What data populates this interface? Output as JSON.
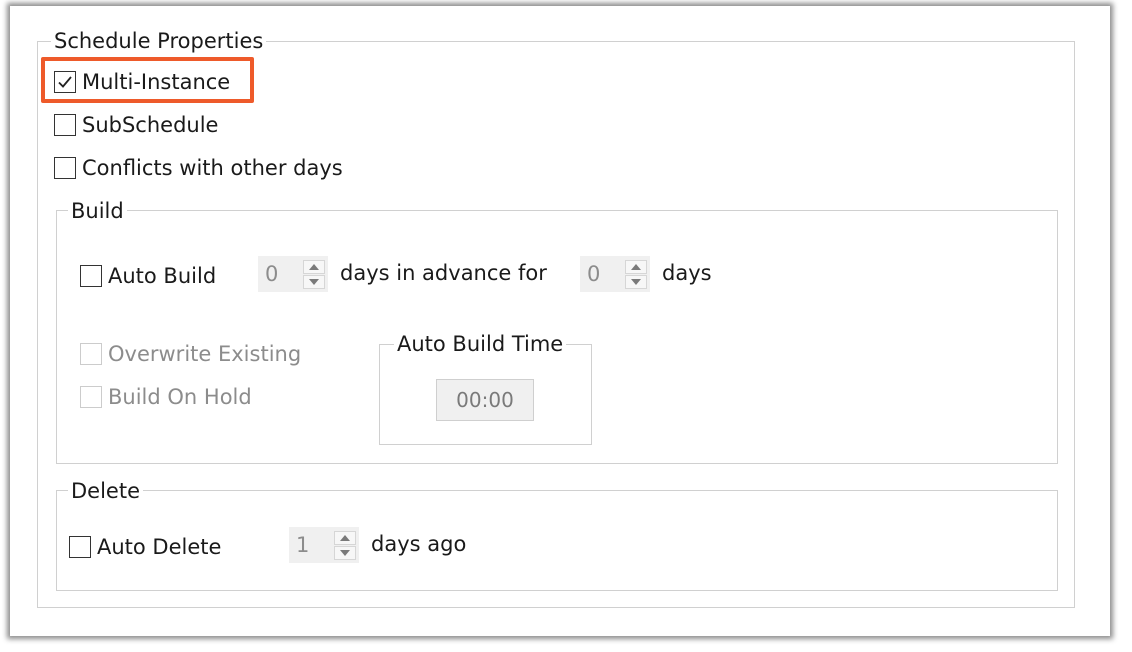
{
  "schedule_properties": {
    "title": "Schedule Properties",
    "multi_instance": {
      "label": "Multi-Instance",
      "checked": true
    },
    "subschedule": {
      "label": "SubSchedule",
      "checked": false
    },
    "conflicts": {
      "label": "Conflicts with other days",
      "checked": false
    }
  },
  "build": {
    "title": "Build",
    "auto_build": {
      "label": "Auto Build",
      "checked": false
    },
    "days_in_advance_value": "0",
    "days_in_advance_text": "days in advance for",
    "days_value": "0",
    "days_text": "days",
    "overwrite_existing": {
      "label": "Overwrite Existing",
      "checked": false,
      "disabled": true
    },
    "build_on_hold": {
      "label": "Build On Hold",
      "checked": false,
      "disabled": true
    },
    "auto_build_time": {
      "title": "Auto Build Time",
      "value": "00:00"
    }
  },
  "delete": {
    "title": "Delete",
    "auto_delete": {
      "label": "Auto Delete",
      "checked": false
    },
    "days_ago_value": "1",
    "days_ago_text": "days ago"
  },
  "colors": {
    "highlight": "#ee5a2a",
    "disabled_text": "#8c8c8c",
    "group_border": "#d0d0d0"
  }
}
